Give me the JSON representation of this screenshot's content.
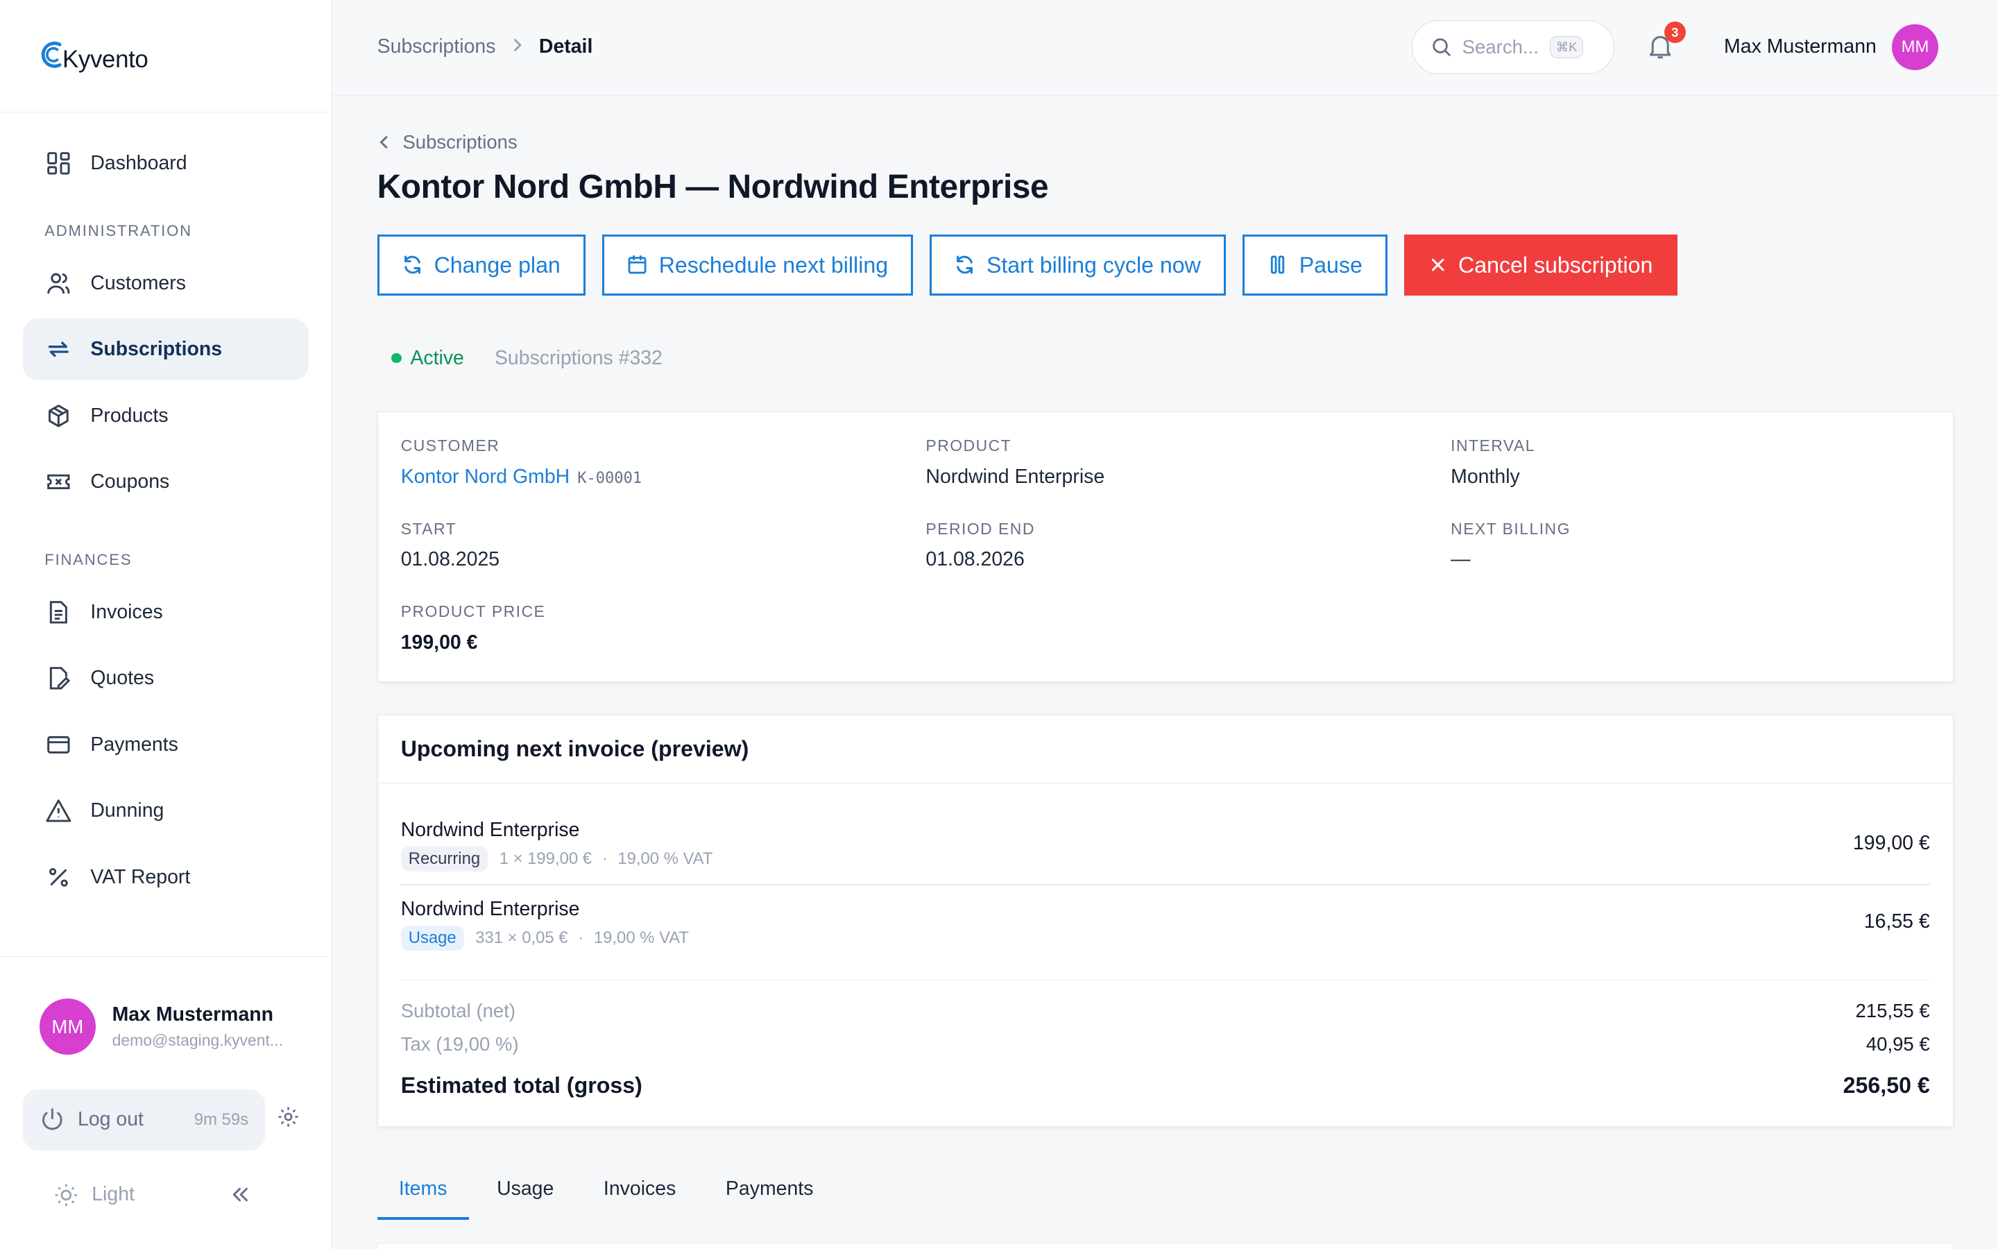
{
  "app": {
    "name": "Kyvento"
  },
  "sidebar": {
    "items_top": [
      {
        "label": "Dashboard",
        "icon": "dashboard-icon"
      }
    ],
    "section_admin": "ADMINISTRATION",
    "admin_items": [
      {
        "label": "Customers",
        "icon": "users-icon"
      },
      {
        "label": "Subscriptions",
        "icon": "repeat-icon",
        "active": true
      },
      {
        "label": "Products",
        "icon": "box-icon"
      },
      {
        "label": "Coupons",
        "icon": "ticket-icon"
      }
    ],
    "section_finances": "FINANCES",
    "finance_items": [
      {
        "label": "Invoices",
        "icon": "file-icon"
      },
      {
        "label": "Quotes",
        "icon": "file-edit-icon"
      },
      {
        "label": "Payments",
        "icon": "credit-card-icon"
      },
      {
        "label": "Dunning",
        "icon": "warning-icon"
      },
      {
        "label": "VAT Report",
        "icon": "percent-icon"
      }
    ],
    "user": {
      "initials": "MM",
      "name": "Max Mustermann",
      "email": "demo@staging.kyvent..."
    },
    "logout": {
      "label": "Log out",
      "timer": "9m 59s"
    },
    "theme_label": "Light"
  },
  "topbar": {
    "breadcrumb": {
      "parent": "Subscriptions",
      "current": "Detail"
    },
    "search": {
      "placeholder": "Search...",
      "shortcut": "⌘K"
    },
    "notifications": "3",
    "user_name": "Max Mustermann",
    "user_initials": "MM"
  },
  "page": {
    "back_label": "Subscriptions",
    "title": "Kontor Nord GmbH — Nordwind Enterprise",
    "actions": {
      "change_plan": "Change plan",
      "reschedule": "Reschedule next billing",
      "start_cycle": "Start billing cycle now",
      "pause": "Pause",
      "cancel": "Cancel subscription"
    },
    "status": "Active",
    "subscription_id": "Subscriptions #332"
  },
  "details": {
    "customer": {
      "label": "CUSTOMER",
      "value": "Kontor Nord GmbH",
      "code": "K-00001"
    },
    "product": {
      "label": "PRODUCT",
      "value": "Nordwind Enterprise"
    },
    "interval": {
      "label": "INTERVAL",
      "value": "Monthly"
    },
    "start": {
      "label": "START",
      "value": "01.08.2025"
    },
    "period_end": {
      "label": "PERIOD END",
      "value": "01.08.2026"
    },
    "next_billing": {
      "label": "NEXT BILLING",
      "value": "—"
    },
    "price": {
      "label": "PRODUCT PRICE",
      "value": "199,00 €"
    }
  },
  "invoice": {
    "title": "Upcoming next invoice (preview)",
    "lines": [
      {
        "name": "Nordwind Enterprise",
        "tag": "Recurring",
        "calc": "1 × 199,00 €",
        "dot": "·",
        "vat": "19,00 % VAT",
        "amount": "199,00 €"
      },
      {
        "name": "Nordwind Enterprise",
        "tag": "Usage",
        "calc": "331 × 0,05 €",
        "dot": "·",
        "vat": "19,00 % VAT",
        "amount": "16,55 €"
      }
    ],
    "subtotal": {
      "label": "Subtotal (net)",
      "value": "215,55 €"
    },
    "tax": {
      "label": "Tax (19,00 %)",
      "value": "40,95 €"
    },
    "total": {
      "label": "Estimated total (gross)",
      "value": "256,50 €"
    }
  },
  "tabs": [
    "Items",
    "Usage",
    "Invoices",
    "Payments"
  ],
  "colors": {
    "accent": "#1c7ed6",
    "danger": "#f03e3e",
    "avatar": "#d63fd0",
    "success": "#12b76a"
  }
}
